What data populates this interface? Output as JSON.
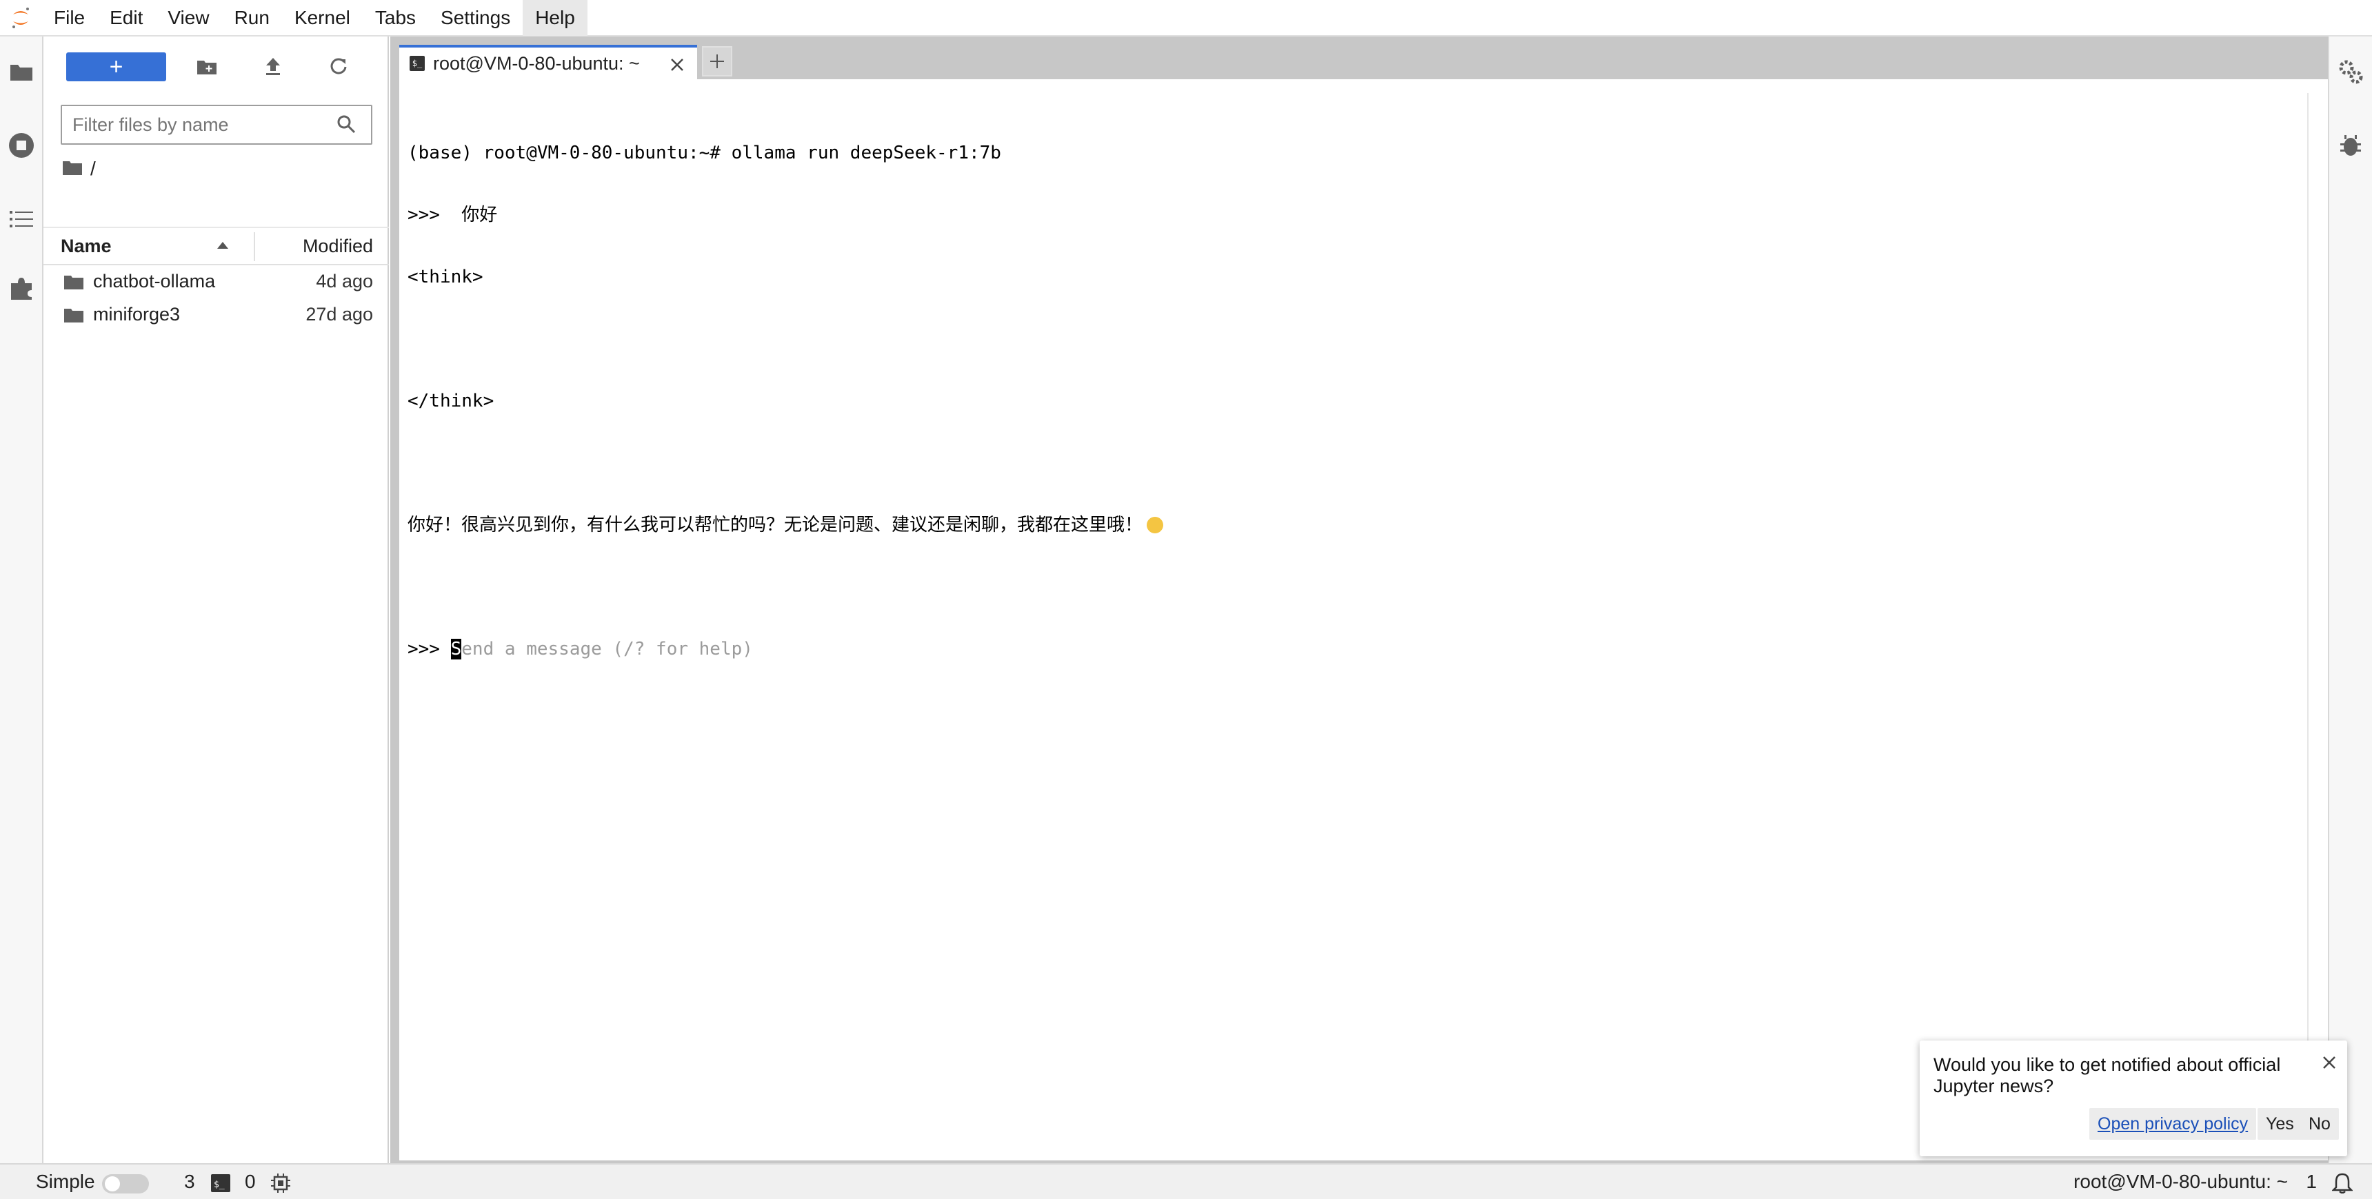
{
  "menubar": {
    "items": [
      "File",
      "Edit",
      "View",
      "Run",
      "Kernel",
      "Tabs",
      "Settings",
      "Help"
    ],
    "active": "Help"
  },
  "filebrowser": {
    "new_label": "+",
    "filter_placeholder": "Filter files by name",
    "breadcrumb": "/",
    "columns": {
      "name": "Name",
      "modified": "Modified"
    },
    "files": [
      {
        "name": "chatbot-ollama",
        "modified": "4d ago",
        "type": "folder"
      },
      {
        "name": "miniforge3",
        "modified": "27d ago",
        "type": "folder"
      }
    ]
  },
  "tabs": [
    {
      "label": "root@VM-0-80-ubuntu: ~",
      "icon": "terminal-icon"
    }
  ],
  "terminal": {
    "lines": [
      "(base) root@VM-0-80-ubuntu:~# ollama run deepSeek-r1:7b",
      ">>>  你好",
      "<think>",
      "",
      "</think>",
      "",
      "你好！很高兴见到你，有什么我可以帮忙的吗？无论是问题、建议还是闲聊，我都在这里哦！",
      ""
    ],
    "prompt": ">>> ",
    "cursor_char": "S",
    "input_hint": "end a message (/? for help)"
  },
  "statusbar": {
    "mode_label": "Simple",
    "terminals_count": "3",
    "kernels_count": "0",
    "right_label": "root@VM-0-80-ubuntu: ~",
    "right_count": "1"
  },
  "notification": {
    "message": "Would you like to get notified about official Jupyter news?",
    "link_label": "Open privacy policy",
    "yes_label": "Yes",
    "no_label": "No"
  },
  "colors": {
    "accent": "#3670d6",
    "logo_orange": "#f37726"
  }
}
